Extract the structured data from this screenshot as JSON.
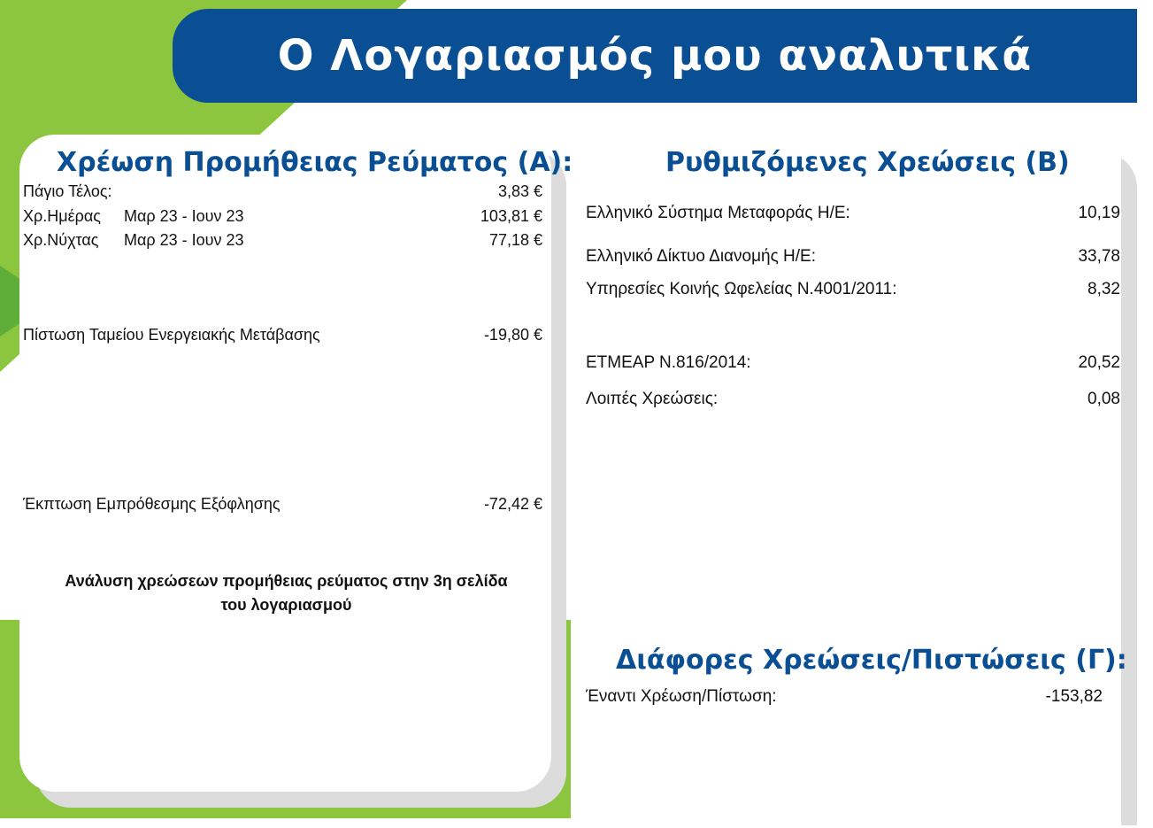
{
  "header": {
    "title": "Ο Λογαριασμός μου αναλυτικά"
  },
  "section_a": {
    "title": "Χρέωση Προμήθειας Ρεύματος (Α):",
    "rows": [
      {
        "label": "Πάγιο Τέλος:",
        "period": "",
        "value": "3,83 €"
      },
      {
        "label": "Χρ.Ημέρας",
        "period": "Μαρ 23 - Ιουν 23",
        "value": "103,81 €"
      },
      {
        "label": "Χρ.Νύχτας",
        "period": "Μαρ 23 - Ιουν 23",
        "value": "77,18 €"
      },
      {
        "label": "Πίστωση Ταμείου Ενεργειακής Μετάβασης",
        "period": "",
        "value": "-19,80 €"
      },
      {
        "label": "Έκπτωση Εμπρόθεσμης Εξόφλησης",
        "period": "",
        "value": "-72,42 €"
      }
    ],
    "note_line1": "Ανάλυση χρεώσεων προμήθειας ρεύματος στην 3η σελίδα",
    "note_line2": "του λογαριασμού"
  },
  "section_b": {
    "title": "Ρυθμιζόμενες Χρεώσεις (Β)",
    "rows": [
      {
        "label": "Ελληνικό Σύστημα Μεταφοράς Η/Ε:",
        "value": "10,19"
      },
      {
        "label": "Ελληνικό Δίκτυο Διανομής Η/Ε:",
        "value": "33,78"
      },
      {
        "label": "Υπηρεσίες Κοινής Ωφελείας Ν.4001/2011:",
        "value": "8,32"
      },
      {
        "label": "ΕΤΜΕΑΡ Ν.816/2014:",
        "value": "20,52"
      },
      {
        "label": "Λοιπές Χρεώσεις:",
        "value": "0,08"
      }
    ]
  },
  "section_c": {
    "title": "Διάφορες Χρεώσεις/Πιστώσεις (Γ):",
    "rows": [
      {
        "label": "Έναντι Χρέωση/Πίστωση:",
        "value": "-153,82"
      }
    ]
  },
  "colors": {
    "brand_blue": "#0a4f93",
    "accent_green": "#8cc63f",
    "panel_shadow": "#dcdcdc"
  }
}
